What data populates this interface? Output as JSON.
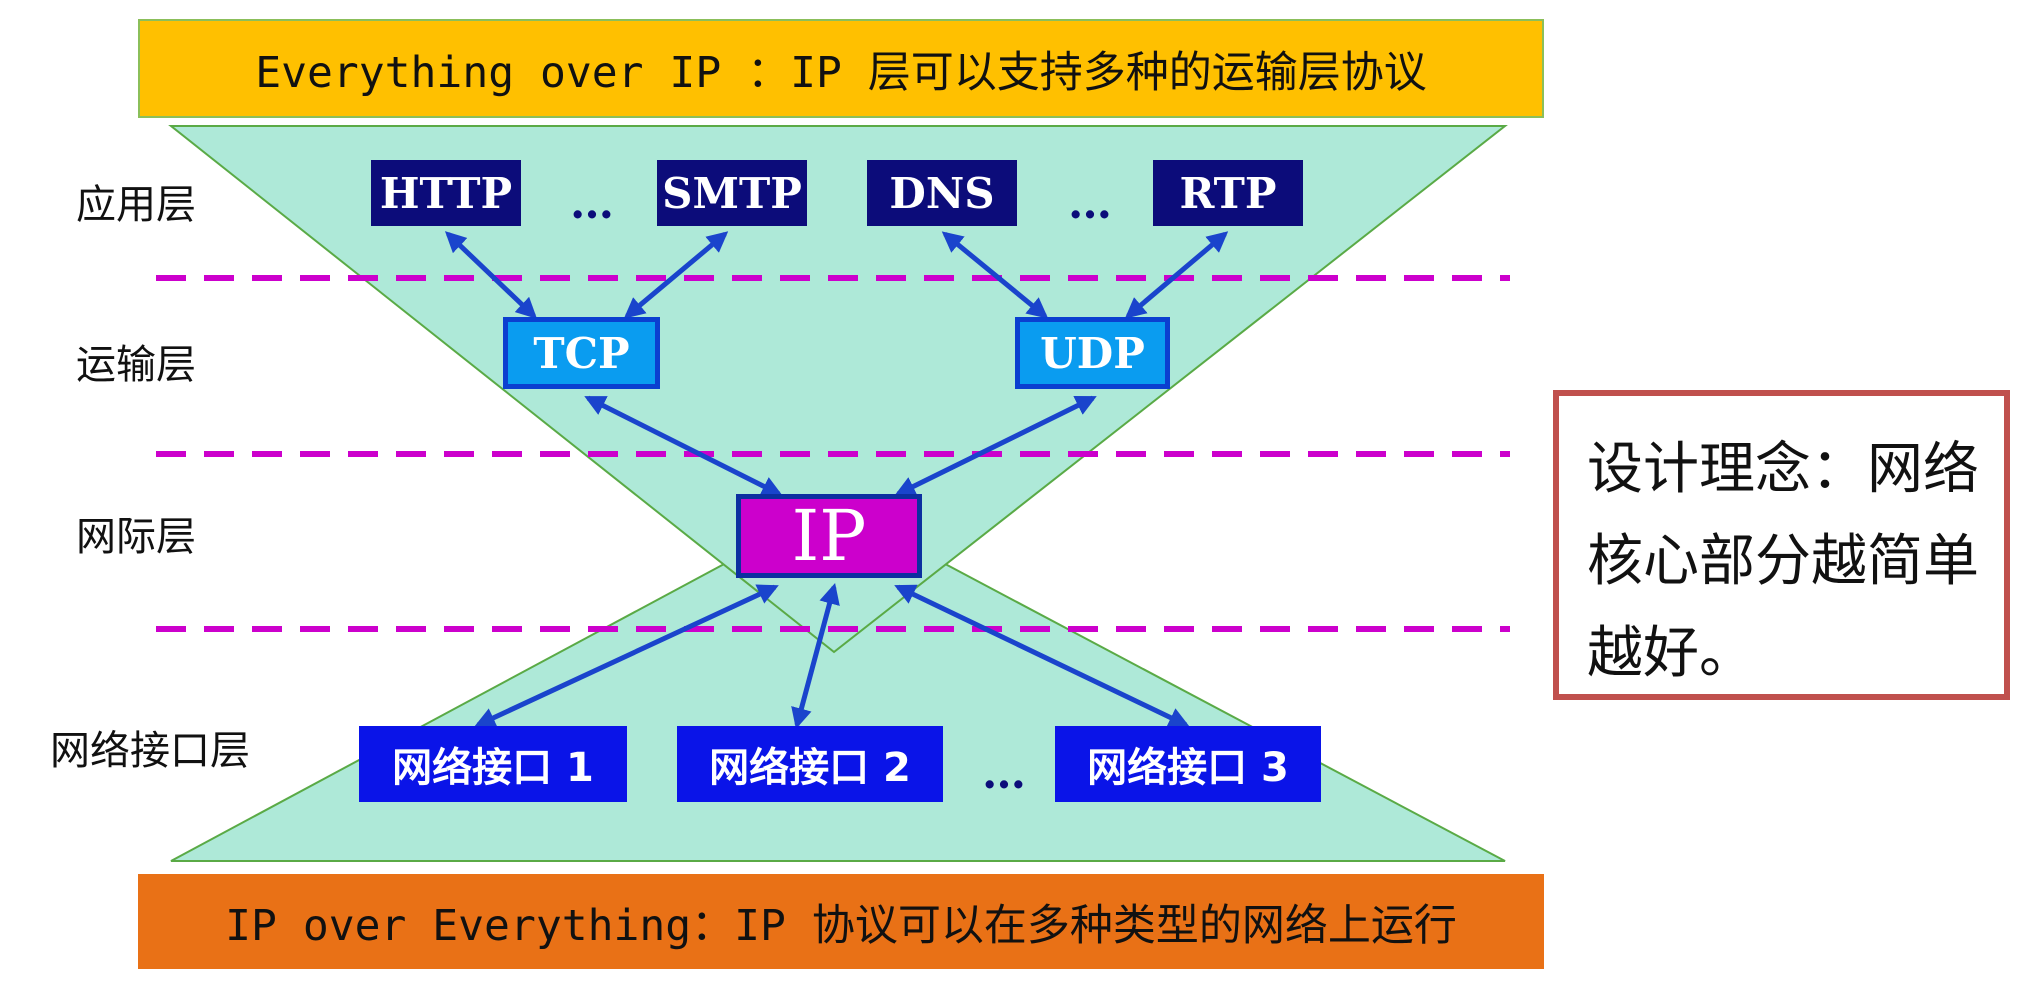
{
  "top_banner": "Everything over IP ：IP 层可以支持多种的运输层协议",
  "bottom_banner": "IP over Everything：IP 协议可以在多种类型的网络上运行",
  "layers": {
    "application": "应用层",
    "transport": "运输层",
    "internet": "网际层",
    "network_interface": "网络接口层"
  },
  "application_protocols": {
    "http": "HTTP",
    "smtp": "SMTP",
    "dns": "DNS",
    "rtp": "RTP",
    "ellipsis_1": "…",
    "ellipsis_2": "…"
  },
  "transport_protocols": {
    "tcp": "TCP",
    "udp": "UDP"
  },
  "internet_protocol": "IP",
  "network_interfaces": {
    "iface_1": "网络接口 1",
    "iface_2": "网络接口 2",
    "iface_3": "网络接口 3",
    "ellipsis": "…"
  },
  "design_principle": "设计理念：网络核心部分越简单越好。",
  "colors": {
    "top_banner": "#ffc000",
    "bottom_banner": "#e97116",
    "hourglass": "#aee9d8",
    "application_box": "#0c0c7a",
    "transport_box": "#0a9cf0",
    "ip_box": "#cc00cc",
    "interface_box": "#0a14e8",
    "arrows": "#1a44cc",
    "divider": "#cc00cc",
    "principle_border": "#c0504d"
  }
}
